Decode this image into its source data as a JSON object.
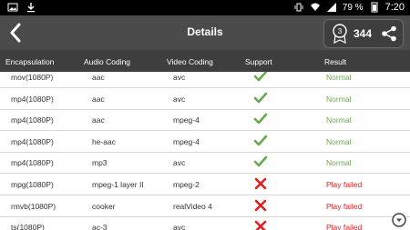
{
  "status": {
    "battery": "79 %",
    "time": "7:20"
  },
  "header": {
    "title": "Details",
    "badge_level": "3",
    "badge_count": "344"
  },
  "table": {
    "columns": [
      "Encapsulation",
      "Audio Coding",
      "Video Coding",
      "Support",
      "Result"
    ],
    "rows": [
      {
        "enc": "mov(1080P)",
        "audio": "aac",
        "video": "avc",
        "support": "check",
        "result": "Normal"
      },
      {
        "enc": "mp4(1080P)",
        "audio": "aac",
        "video": "avc",
        "support": "check",
        "result": "Normal"
      },
      {
        "enc": "mp4(1080P)",
        "audio": "aac",
        "video": "mpeg-4",
        "support": "check",
        "result": "Normal"
      },
      {
        "enc": "mp4(1080P)",
        "audio": "he-aac",
        "video": "mpeg-4",
        "support": "check",
        "result": "Normal"
      },
      {
        "enc": "mp4(1080P)",
        "audio": "mp3",
        "video": "avc",
        "support": "check",
        "result": "Normal"
      },
      {
        "enc": "mpg(1080P)",
        "audio": "mpeg-1 layer II",
        "video": "mpeg-2",
        "support": "cross",
        "result": "Play failed"
      },
      {
        "enc": "rmvb(1080P)",
        "audio": "cooker",
        "video": "realVideo 4",
        "support": "cross",
        "result": "Play failed"
      },
      {
        "enc": "ts(1080P)",
        "audio": "ac-3",
        "video": "avc",
        "support": "cross",
        "result": "Play failed"
      }
    ]
  },
  "colors": {
    "appbar": "#4b4b4b",
    "header_row": "#3e3e3e",
    "ok": "#6aa84f",
    "fail": "#e02020"
  }
}
